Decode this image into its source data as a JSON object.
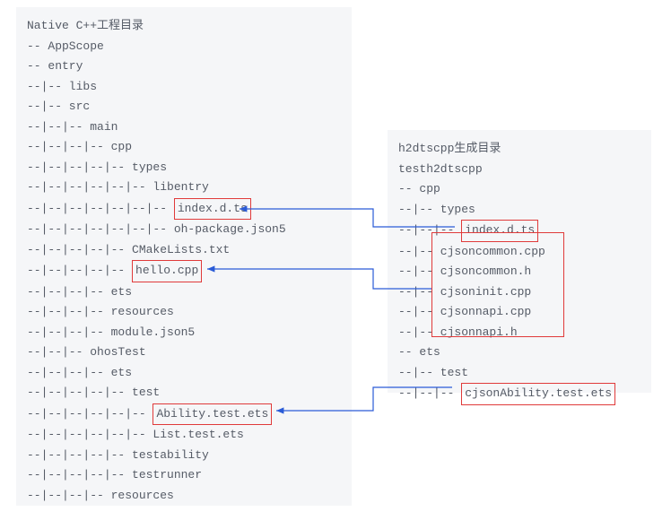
{
  "left": {
    "title": "Native C++工程目录",
    "lines": {
      "l1": "-- AppScope",
      "l2": "-- entry",
      "l3": "--|-- libs",
      "l4": "--|-- src",
      "l5": "--|--|-- main",
      "l6": "--|--|--|-- cpp",
      "l7": "--|--|--|--|-- types",
      "l8": "--|--|--|--|--|-- libentry",
      "l9p": "--|--|--|--|--|--|-- ",
      "l9h": "index.d.ts",
      "l10": "--|--|--|--|--|--|-- oh-package.json5",
      "l11": "--|--|--|--|-- CMakeLists.txt",
      "l12p": "--|--|--|--|-- ",
      "l12h": "hello.cpp",
      "l13": "--|--|--|-- ets",
      "l14": "--|--|--|-- resources",
      "l15": "--|--|--|-- module.json5",
      "l16": "--|--|-- ohosTest",
      "l17": "--|--|--|-- ets",
      "l18": "--|--|--|--|-- test",
      "l19p": "--|--|--|--|--|-- ",
      "l19h": "Ability.test.ets",
      "l20": "--|--|--|--|--|-- List.test.ets",
      "l21": "--|--|--|--|-- testability",
      "l22": "--|--|--|--|-- testrunner",
      "l23": "--|--|--|-- resources"
    }
  },
  "right": {
    "title": "h2dtscpp生成目录",
    "sub": "testh2dtscpp",
    "lines": {
      "r1": "-- cpp",
      "r2": "--|-- types",
      "r3p": "--|--|-- ",
      "r3h": "index.d.ts",
      "r4": "--|-- cjsoncommon.cpp",
      "r5": "--|-- cjsoncommon.h",
      "r6": "--|-- cjsoninit.cpp",
      "r7": "--|-- cjsonnapi.cpp",
      "r8": "--|-- cjsonnapi.h",
      "r9": "-- ets",
      "r10": "--|-- test",
      "r11p": "--|--|-- ",
      "r11h": "cjsonAbility.test.ets"
    }
  }
}
